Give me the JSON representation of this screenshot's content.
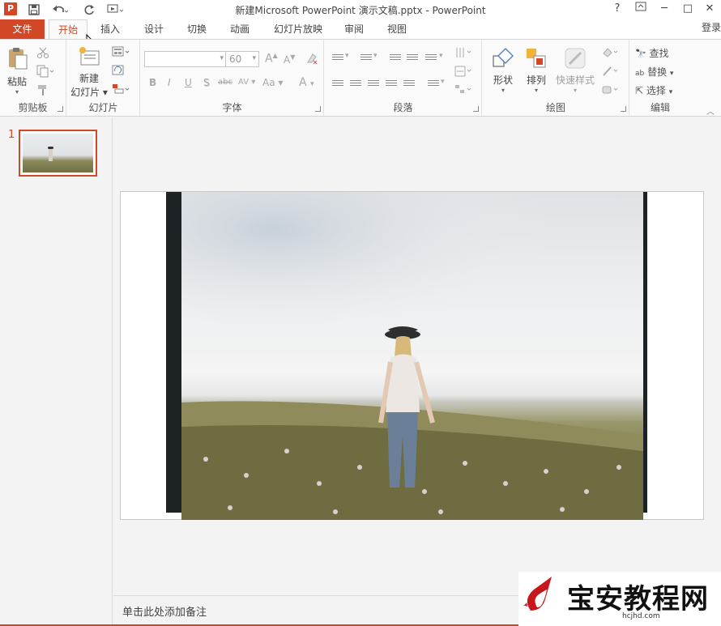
{
  "window": {
    "app_badge": "P",
    "title": "新建Microsoft PowerPoint 演示文稿.pptx - PowerPoint",
    "help": "?",
    "min": "─",
    "max": "□",
    "close": "✕"
  },
  "tabs": {
    "file": "文件",
    "items": [
      "开始",
      "插入",
      "设计",
      "切换",
      "动画",
      "幻灯片放映",
      "审阅",
      "视图"
    ],
    "active": "开始",
    "signin": "登录"
  },
  "ribbon": {
    "clipboard": {
      "label": "剪贴板",
      "paste": "粘贴"
    },
    "slides": {
      "label": "幻灯片",
      "new_slide_line1": "新建",
      "new_slide_line2": "幻灯片"
    },
    "font": {
      "label": "字体",
      "font_name": "",
      "font_size": "60",
      "bold": "B",
      "italic": "I",
      "underline": "U",
      "shadow": "S",
      "strike": "abc",
      "spacing": "AV",
      "case": "Aa",
      "color": "A",
      "grow": "A",
      "shrink": "A"
    },
    "paragraph": {
      "label": "段落"
    },
    "drawing": {
      "label": "绘图",
      "shapes": "形状",
      "arrange": "排列",
      "quick_styles": "快速样式"
    },
    "editing": {
      "label": "编辑",
      "find": "查找",
      "replace": "替换",
      "select": "选择"
    }
  },
  "thumbnails": [
    {
      "number": "1"
    }
  ],
  "notes": {
    "placeholder": "单击此处添加备注"
  },
  "watermark": {
    "brand": "宝安教程网",
    "url": "hcjhd.com"
  },
  "colors": {
    "accent": "#d24726",
    "ribbon_bg": "#fafafa",
    "panel_bg": "#f3f3f3"
  }
}
